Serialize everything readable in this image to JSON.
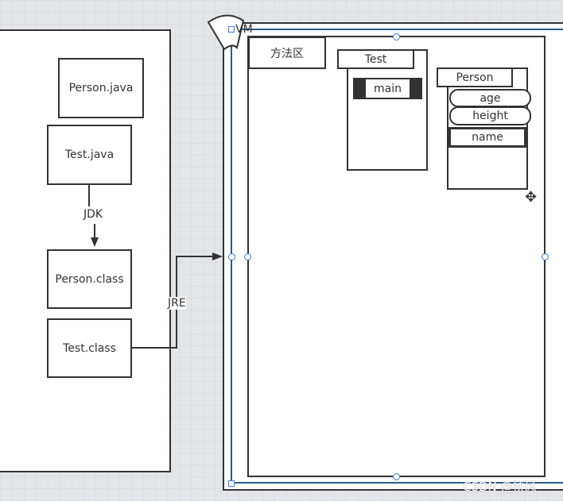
{
  "left_panel": {
    "files": [
      "Person.java",
      "Test.java",
      "Person.class",
      "Test.class"
    ],
    "jdk_label": "JDK",
    "jre_label": "JRE"
  },
  "vm": {
    "label": "VM",
    "method_area": "方法区",
    "test_class": {
      "name": "Test",
      "method": "main"
    },
    "person_class": {
      "name": "Person",
      "fields": [
        "age",
        "height",
        "name"
      ]
    }
  },
  "watermark": "CSDN @扶风",
  "colors": {
    "stroke": "#333333",
    "selection": "#3a7bd5"
  }
}
